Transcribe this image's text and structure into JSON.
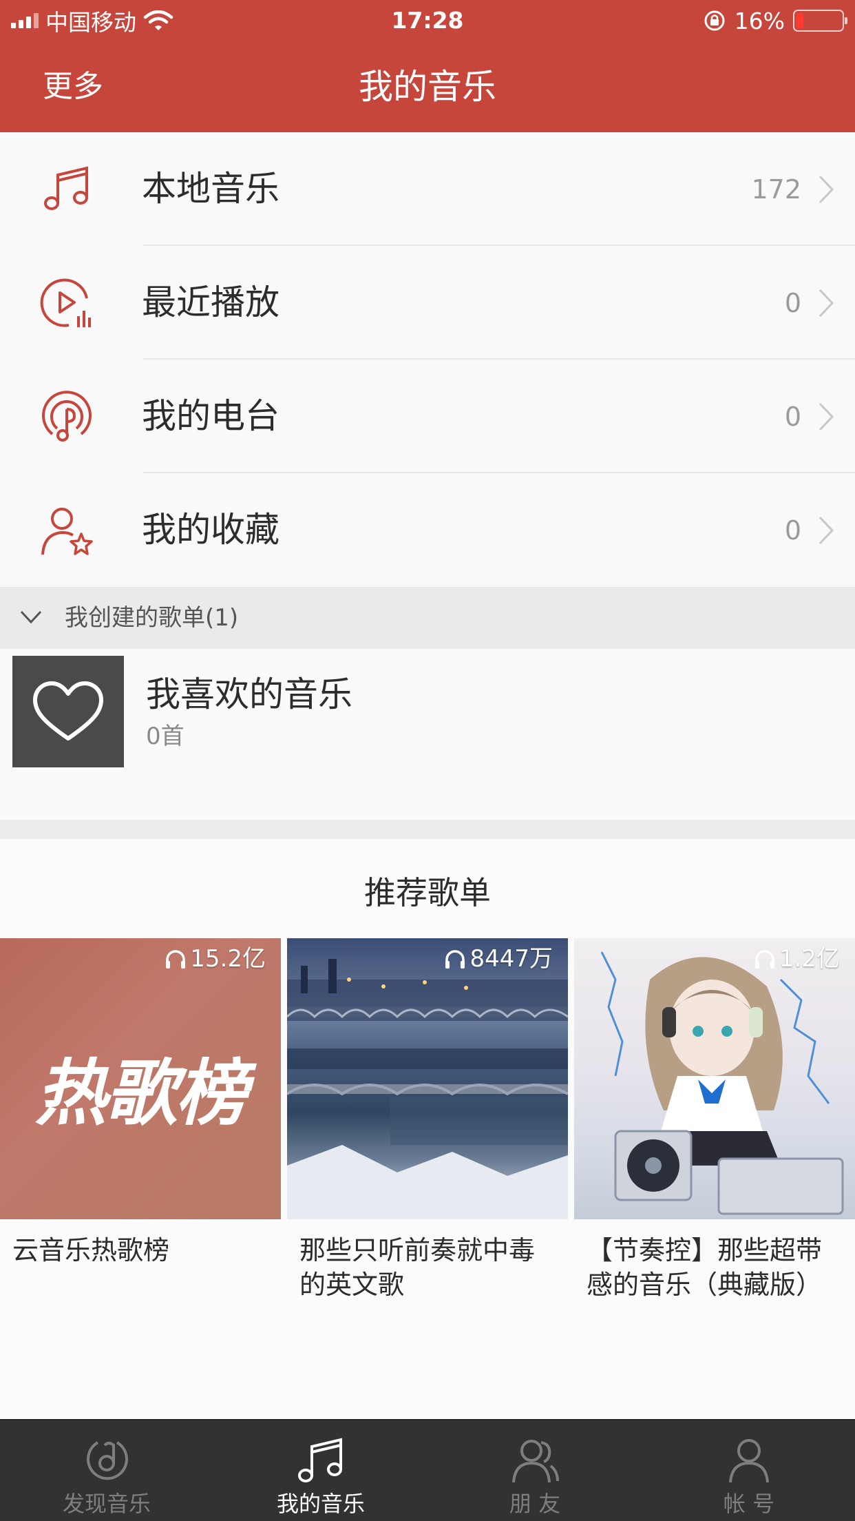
{
  "status_bar": {
    "carrier": "中国移动",
    "time": "17:28",
    "battery_percent": "16%",
    "battery_level": 0.16
  },
  "header": {
    "left_label": "更多",
    "title": "我的音乐"
  },
  "menu": {
    "items": [
      {
        "label": "本地音乐",
        "count": "172",
        "icon": "music-note-icon"
      },
      {
        "label": "最近播放",
        "count": "0",
        "icon": "recent-play-icon"
      },
      {
        "label": "我的电台",
        "count": "0",
        "icon": "radio-icon"
      },
      {
        "label": "我的收藏",
        "count": "0",
        "icon": "favorite-user-star-icon"
      }
    ]
  },
  "created_playlists": {
    "section_title": "我创建的歌单(1)",
    "items": [
      {
        "name": "我喜欢的音乐",
        "count": "0首",
        "icon": "heart-icon"
      }
    ]
  },
  "recommend": {
    "title": "推荐歌单",
    "items": [
      {
        "plays": "15.2亿",
        "name": "云音乐热歌榜",
        "cover_text": "热歌榜"
      },
      {
        "plays": "8447万",
        "name": "那些只听前奏就中毒的英文歌"
      },
      {
        "plays": "1.2亿",
        "name": "【节奏控】那些超带感的音乐（典藏版）"
      }
    ]
  },
  "tabbar": {
    "items": [
      {
        "label": "发现音乐",
        "icon": "discover-music-icon",
        "active": false
      },
      {
        "label": "我的音乐",
        "icon": "music-note-icon",
        "active": true
      },
      {
        "label": "朋 友",
        "icon": "friends-icon",
        "active": false
      },
      {
        "label": "帐 号",
        "icon": "account-icon",
        "active": false
      }
    ]
  },
  "colors": {
    "brand_red": "#c6463b",
    "tabbar_bg": "#323232"
  }
}
